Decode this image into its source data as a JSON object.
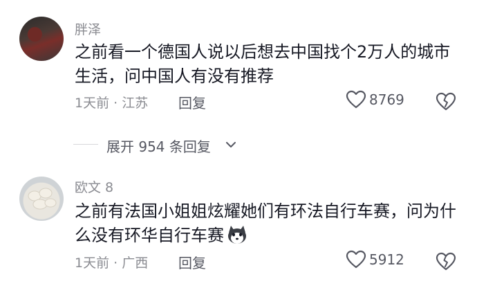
{
  "comments": [
    {
      "username": "胖泽",
      "text": "之前看一个德国人说以后想去中国找个2万人的城市生活，问中国人有没有推荐",
      "time": "1天前",
      "location": "江苏",
      "reply_label": "回复",
      "likes": "8769"
    },
    {
      "username": "欧文 8",
      "text": "之前有法国小姐姐炫耀她们有环法自行车赛，问为什么没有环华自行车赛",
      "time": "1天前",
      "location": "广西",
      "reply_label": "回复",
      "likes": "5912"
    }
  ],
  "expand_replies": {
    "label": "展开 954 条回复"
  },
  "icons": {
    "like": "heart-outline-icon",
    "dislike": "broken-heart-icon",
    "expand": "chevron-down-icon",
    "emoji": "husky-emoji-icon"
  },
  "colors": {
    "text": "#161823",
    "muted": "#8a8b91",
    "action": "#555761"
  }
}
